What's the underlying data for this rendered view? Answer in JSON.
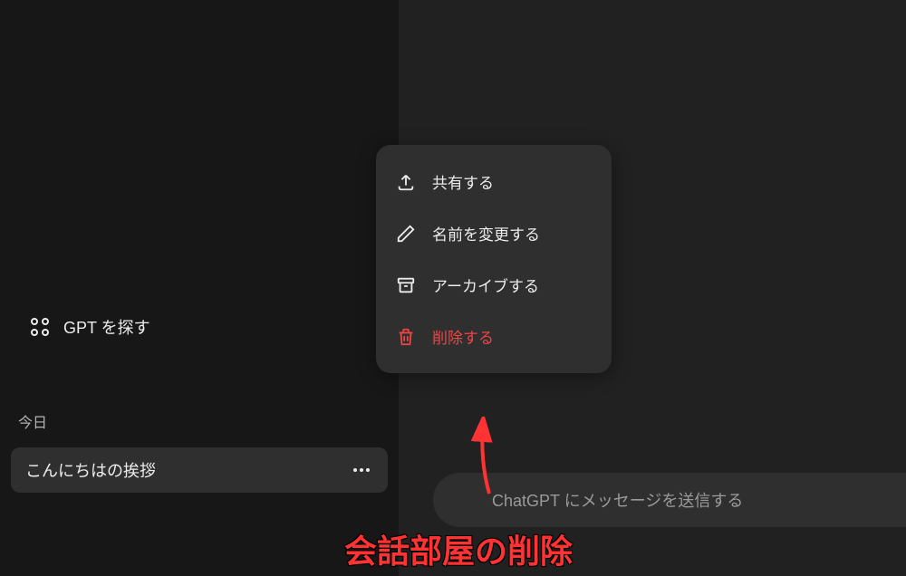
{
  "sidebar": {
    "nav": {
      "explore_label": "GPT を探す"
    },
    "section_header": "今日",
    "chat": {
      "title": "こんにちはの挨拶"
    }
  },
  "context_menu": {
    "share": "共有する",
    "rename": "名前を変更する",
    "archive": "アーカイブする",
    "delete": "削除する"
  },
  "input": {
    "placeholder": "ChatGPT にメッセージを送信する"
  },
  "annotation": {
    "text": "会話部屋の削除",
    "arrow_color": "#ff3333"
  }
}
